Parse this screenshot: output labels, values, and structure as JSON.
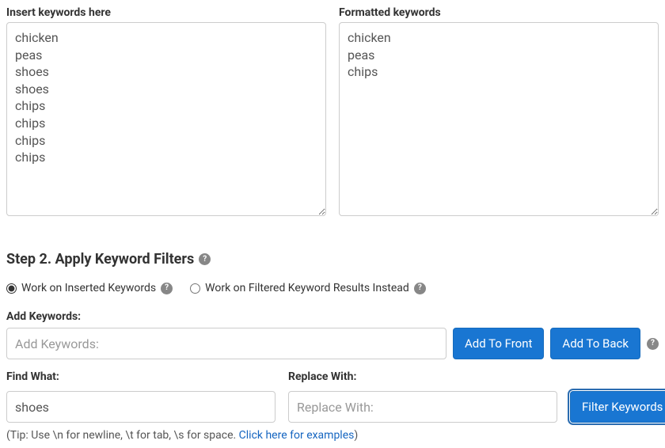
{
  "keywordsPanel": {
    "insertLabel": "Insert keywords here",
    "formattedLabel": "Formatted keywords",
    "insertedText": "chicken\npeas\nshoes\nshoes\nchips\nchips\nchips\nchips",
    "formattedText": "chicken\npeas\nchips"
  },
  "step2": {
    "heading": "Step 2. Apply Keyword Filters",
    "radios": {
      "inserted": "Work on Inserted Keywords",
      "filtered": "Work on Filtered Keyword Results Instead"
    }
  },
  "addKeywords": {
    "label": "Add Keywords:",
    "placeholder": "Add Keywords:",
    "addFront": "Add To Front",
    "addBack": "Add To Back"
  },
  "findReplace": {
    "findLabel": "Find What:",
    "findValue": "shoes",
    "replaceLabel": "Replace With:",
    "replacePlaceholder": "Replace With:",
    "filterBtn": "Filter Keywords"
  },
  "tip": {
    "prefix": "(Tip: Use \\n for newline, \\t for tab, \\s for space. ",
    "link": "Click here for examples",
    "suffix": ")"
  }
}
